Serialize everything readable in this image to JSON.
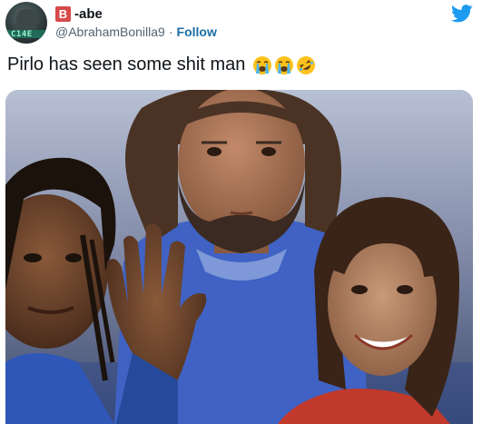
{
  "tweet": {
    "badge_letter": "B",
    "display_name": "-abe",
    "handle": "@AbrahamBonilla9",
    "separator": "·",
    "follow_label": "Follow",
    "avatar_tag": "C14E",
    "text": "Pirlo has seen some shit man",
    "emojis": [
      "loudly-crying-face",
      "loudly-crying-face",
      "rolling-on-floor-laughing"
    ]
  },
  "colors": {
    "twitter_blue": "#1d9bf0",
    "badge_red": "#d84a4a",
    "follow_blue": "#1b6ea8",
    "handle_gray": "#536471"
  },
  "media": {
    "description_icon": "photo"
  }
}
